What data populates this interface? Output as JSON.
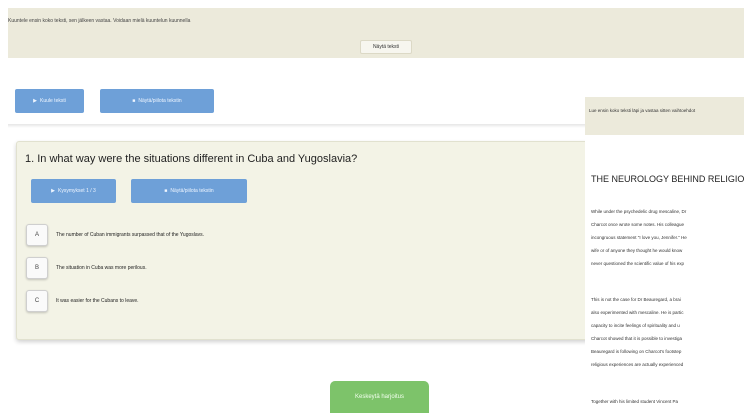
{
  "banner": {
    "text": "Kuuntele ensin koko teksti, sen jälkeen vastaa. Voidaan mielä kuuntelun kuunnella",
    "button_label": "Näytä teksti"
  },
  "toolbar": {
    "play_label": "Kuule teksti",
    "show_text_label": "Näytä/piilota tekstin"
  },
  "question": {
    "number_title": "1. In what way were the situations different in Cuba and Yugoslavia?",
    "play_label": "Kysymykset 1 / 3",
    "show_text_label": "Näytä/piilota tekstin",
    "options": [
      {
        "letter": "A",
        "text": "The number of Cuban immigrants surpassed that of the Yugoslavs."
      },
      {
        "letter": "B",
        "text": "The situation in Cuba was more perilous."
      },
      {
        "letter": "C",
        "text": "It was easier for the Cubans to leave."
      }
    ]
  },
  "side_panel": {
    "header_text": "Lue ensin koko teksti läpi ja vastaa sitten vaihtoehdot",
    "title": "THE NEUROLOGY BEHIND RELIGIOUS",
    "paragraph1": [
      "While under the psychedelic drug mescaline, Dr",
      "Charcot once wrote some notes. His colleague",
      "incongruous statement \"I love you, Jennifer.\" He",
      "wife or of anyone they thought he would know",
      "never questioned the scientific value of his exp"
    ],
    "paragraph2": [
      "This is not the case for Dr Beauregard, a brai",
      "also experimented with mescaline. He is partic",
      "capacity to incite feelings of spirituality and u",
      "Charcot showed that it is possible to investiga",
      "Beauregard is following on Charcot's footstep",
      "religious experiences are actually experienced"
    ],
    "paragraph3_first": "Together with his limited student Vincent Pa"
  },
  "continue_label": "Keskeytä harjoitus",
  "colors": {
    "banner_bg": "#eceadb",
    "primary_button": "#6ea0d8",
    "continue_button": "#7dc36a",
    "question_panel_bg": "#f3f3e6"
  }
}
